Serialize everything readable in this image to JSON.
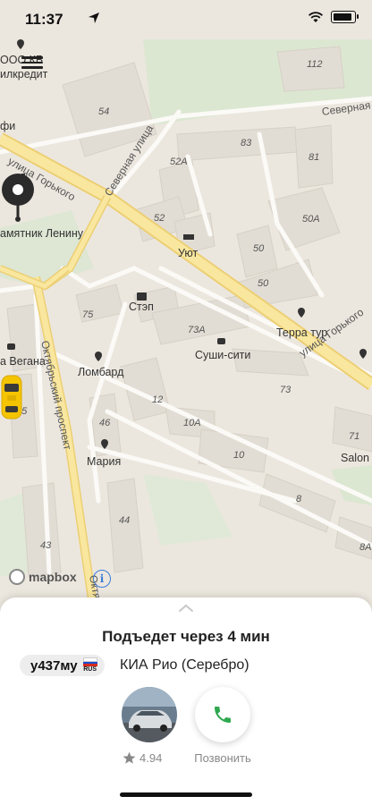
{
  "status_bar": {
    "time": "11:37",
    "icons": [
      "location-arrow-icon",
      "wifi-icon",
      "battery-icon"
    ]
  },
  "map": {
    "attribution": "mapbox",
    "info_symbol": "i",
    "streets": {
      "gorkogo_left": "улица Горького",
      "gorkogo_right": "улица Горького",
      "severnaya_diag": "Северная улица",
      "severnaya_top": "Северная",
      "oktyabrsky": "Октябрьский проспект",
      "oktyabrsky_bottom": "Октябрь"
    },
    "pois": {
      "ooo": "ООО КБ",
      "bank": "илкредит",
      "cafe_partial": "фи",
      "lenin": "амятник Ленину",
      "uyut": "Уют",
      "step": "Стэп",
      "terra": "Терра тур",
      "sushi": "Суши-сити",
      "vegana": "а Вегана",
      "lombard": "Ломбард",
      "mariya": "Мария",
      "salon": "Salon"
    },
    "building_numbers": [
      "112",
      "54",
      "83",
      "52А",
      "81",
      "52",
      "50А",
      "50",
      "50",
      "75",
      "73А",
      "73",
      "45",
      "46",
      "12",
      "10А",
      "10",
      "71",
      "8",
      "44",
      "43",
      "8А"
    ]
  },
  "sheet": {
    "eta_text": "Подъедет через 4 мин",
    "plate_number": "у437му",
    "plate_country": "RUS",
    "car_model": "КИА Рио (Серебро)",
    "driver_rating": "4.94",
    "call_label": "Позвонить",
    "colors": {
      "call_icon": "#2fa84f",
      "taxi": "#f5c400"
    }
  }
}
